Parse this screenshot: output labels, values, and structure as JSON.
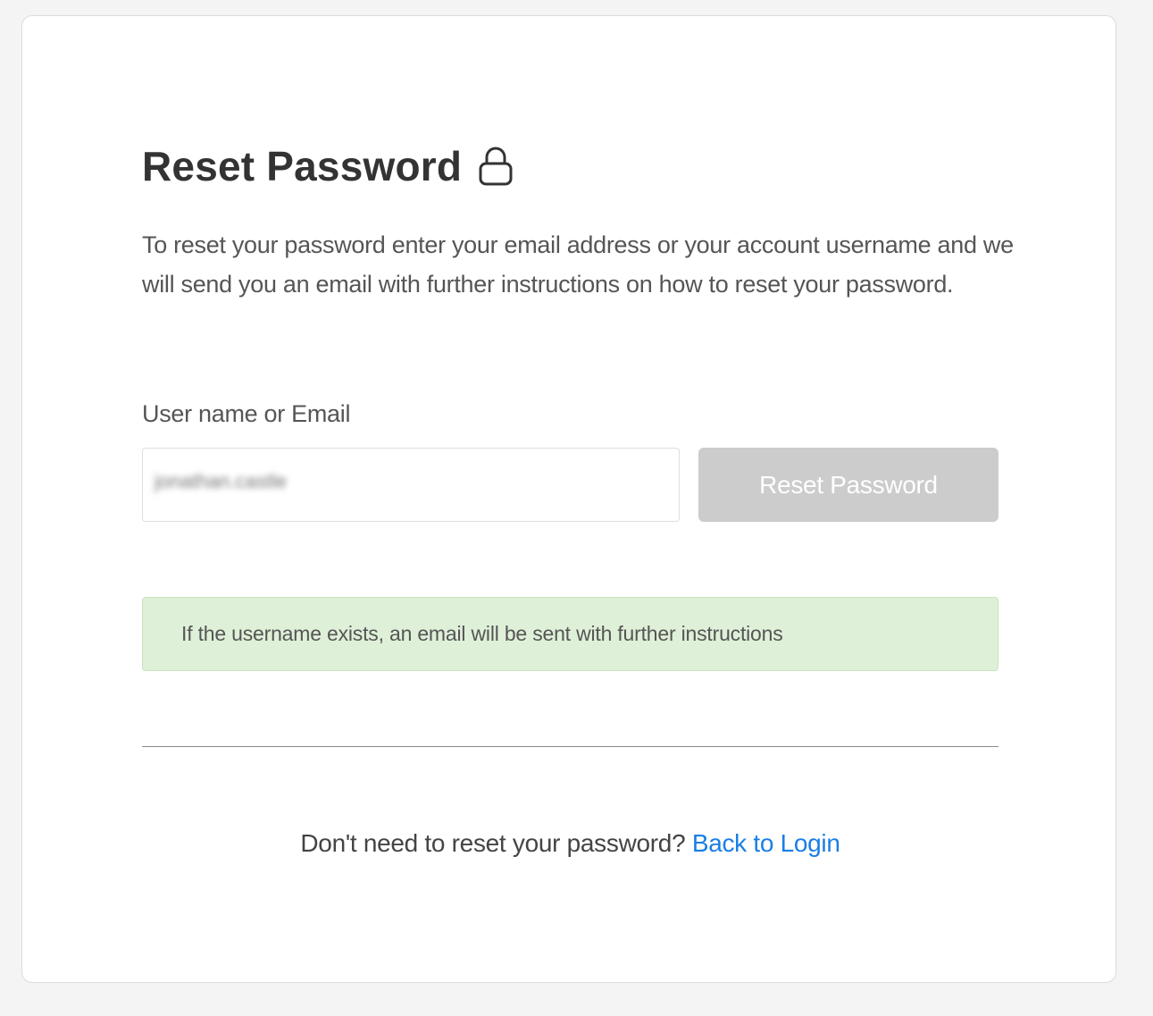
{
  "page": {
    "title": "Reset Password",
    "title_icon": "lock-icon",
    "description": "To reset your password enter your email address or your account username and we will send you an email with further instructions on how to reset your password."
  },
  "form": {
    "field_label": "User name or Email",
    "input_value": "jonathan.castle",
    "submit_label": "Reset Password",
    "submit_enabled": false
  },
  "alert": {
    "type": "success",
    "message": "If the username exists, an email will be sent with further instructions"
  },
  "footer": {
    "prompt": "Don't need to reset your password?",
    "link_label": "Back to Login"
  },
  "colors": {
    "background": "#f4f4f4",
    "card": "#ffffff",
    "button_disabled": "#cccccc",
    "alert_success_bg": "#dff0d8",
    "link": "#1a7ee6"
  }
}
